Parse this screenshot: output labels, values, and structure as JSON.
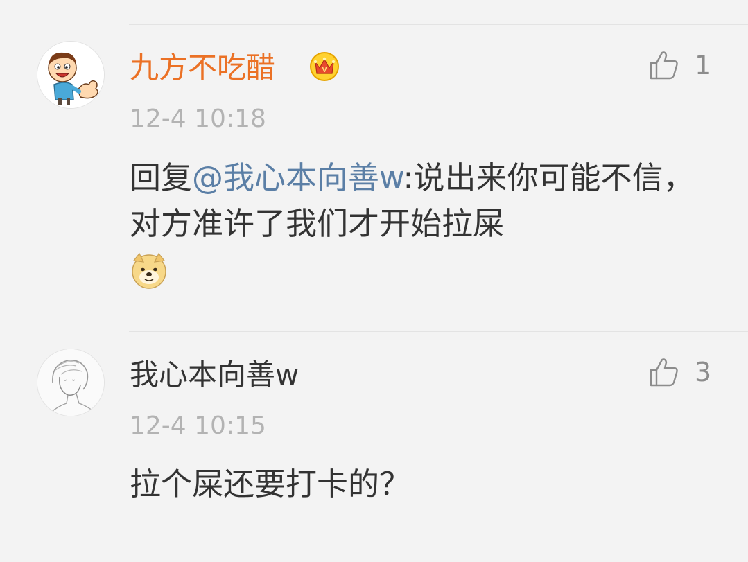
{
  "comments": [
    {
      "username": "九方不吃醋",
      "is_vip": true,
      "timestamp": "12-4 10:18",
      "like_count": "1",
      "reply_prefix": "回复",
      "mention": "@我心本向善w",
      "text": ":说出来你可能不信，对方准许了我们才开始拉屎",
      "emoji": "doge-emoji"
    },
    {
      "username": "我心本向善w",
      "is_vip": false,
      "timestamp": "12-4 10:15",
      "like_count": "3",
      "text": "拉个屎还要打卡的？"
    }
  ],
  "colors": {
    "vip_name": "#eb7125",
    "name": "#333333",
    "mention": "#5b7fa6",
    "timestamp": "#b3b3b3",
    "like": "#8c8c8c",
    "background": "#f3f3f3"
  }
}
